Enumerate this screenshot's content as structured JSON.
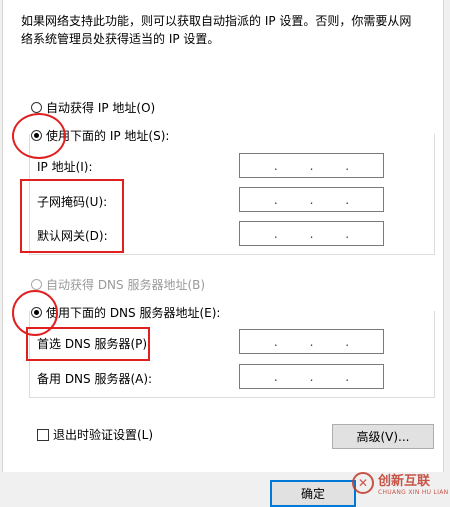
{
  "description": {
    "line1": "如果网络支持此功能，则可以获取自动指派的 IP 设置。否则，你需要从网",
    "line2": "络系统管理员处获得适当的 IP 设置。"
  },
  "ip": {
    "auto_label": "自动获得 IP 地址(O)",
    "manual_label": "使用下面的 IP 地址(S):",
    "fields": [
      {
        "label": "IP 地址(I):",
        "value": ". . ."
      },
      {
        "label": "子网掩码(U):",
        "value": ". . ."
      },
      {
        "label": "默认网关(D):",
        "value": ". . ."
      }
    ]
  },
  "dns": {
    "auto_label": "自动获得 DNS 服务器地址(B)",
    "manual_label": "使用下面的 DNS 服务器地址(E):",
    "fields": [
      {
        "label": "首选 DNS 服务器(P):",
        "value": ". . ."
      },
      {
        "label": "备用 DNS 服务器(A):",
        "value": ". . ."
      }
    ]
  },
  "validate_label": "退出时验证设置(L)",
  "advanced_button": "高级(V)...",
  "ok_button": "确定",
  "watermark": {
    "text": "创新互联",
    "subtext": "CHUANG XIN HU LIAN"
  },
  "colors": {
    "annotation_red": "#e02020",
    "focus_blue": "#0078d7"
  }
}
